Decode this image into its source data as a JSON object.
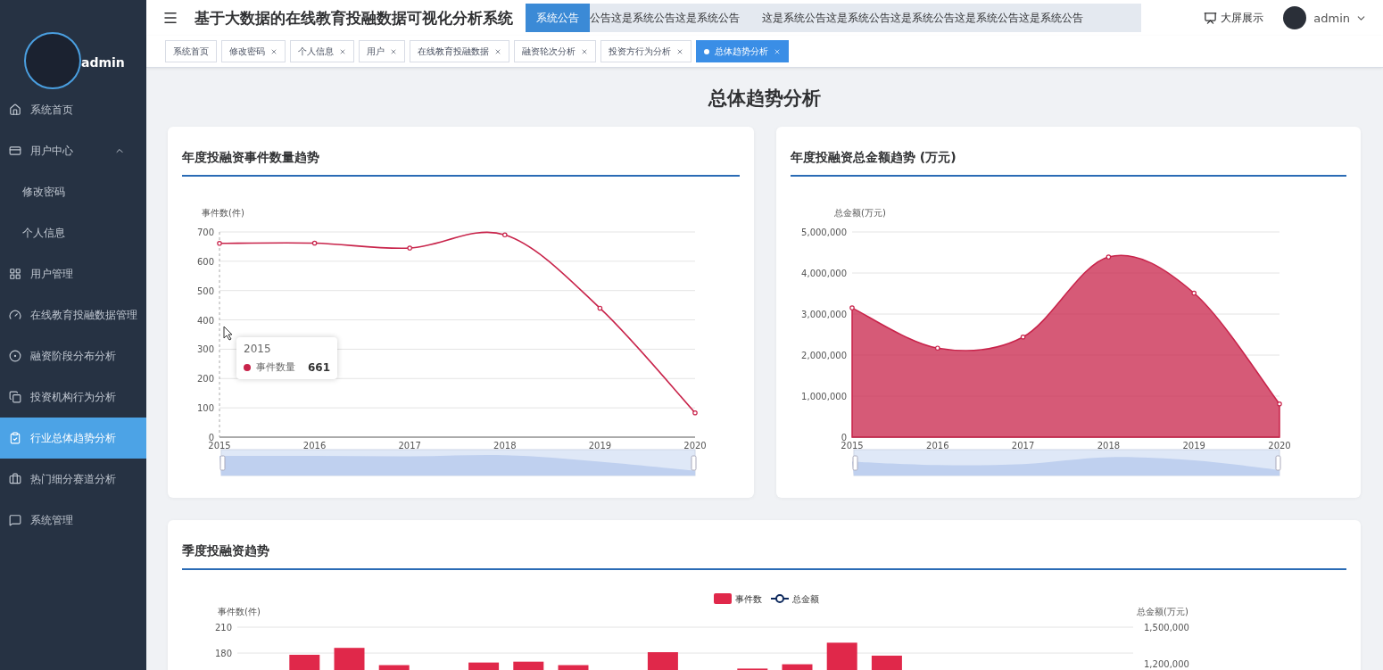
{
  "header": {
    "title": "基于大数据的在线教育投融数据可视化分析系统",
    "notice_label": "系统公告",
    "notice_texts": [
      "公告这是系统公告这是系统公告",
      "这是系统公告这是系统公告这是系统公告这是系统公告这是系统公告"
    ],
    "screen_button": "大屏展示",
    "user": "admin"
  },
  "sidebar": {
    "user": "admin",
    "items": [
      {
        "label": "系统首页",
        "selected": false
      },
      {
        "label": "用户中心",
        "selected": false,
        "expanded": true,
        "children": [
          {
            "label": "修改密码",
            "selected": false
          },
          {
            "label": "个人信息",
            "selected": false
          }
        ]
      },
      {
        "label": "用户管理",
        "selected": false
      },
      {
        "label": "在线教育投融数据管理",
        "selected": false
      },
      {
        "label": "融资阶段分布分析",
        "selected": false
      },
      {
        "label": "投资机构行为分析",
        "selected": false
      },
      {
        "label": "行业总体趋势分析",
        "selected": true
      },
      {
        "label": "热门细分赛道分析",
        "selected": false
      },
      {
        "label": "系统管理",
        "selected": false
      }
    ]
  },
  "tabs": [
    {
      "label": "系统首页",
      "selected": false,
      "closable": false
    },
    {
      "label": "修改密码",
      "selected": false,
      "closable": true
    },
    {
      "label": "个人信息",
      "selected": false,
      "closable": true
    },
    {
      "label": "用户",
      "selected": false,
      "closable": true
    },
    {
      "label": "在线教育投融数据",
      "selected": false,
      "closable": true
    },
    {
      "label": "融资轮次分析",
      "selected": false,
      "closable": true
    },
    {
      "label": "投资方行为分析",
      "selected": false,
      "closable": true
    },
    {
      "label": "总体趋势分析",
      "selected": true,
      "closable": true
    }
  ],
  "page_title": "总体趋势分析",
  "cards": [
    {
      "title": "年度投融资事件数量趋势",
      "tooltip": {
        "title": "2015",
        "value": "661"
      },
      "chart_data": {
        "type": "line",
        "grid": true,
        "ylabel": "事件数(件)",
        "categories": [
          "2015",
          "2016",
          "2017",
          "2018",
          "2019",
          "2020"
        ],
        "ylim": [
          0,
          700
        ],
        "yticks": [
          0,
          100,
          200,
          300,
          400,
          500,
          600,
          700
        ],
        "series": [
          {
            "name": "事件数量",
            "color": "#c8234a",
            "marker": true,
            "values": [
              661,
              662,
              645,
              690,
              440,
              83
            ]
          }
        ]
      }
    },
    {
      "title": "年度投融资总金额趋势 (万元)",
      "chart_data": {
        "type": "area",
        "grid": true,
        "ylabel": "总金额(万元)",
        "categories": [
          "2015",
          "2016",
          "2017",
          "2018",
          "2019",
          "2020"
        ],
        "ylim": [
          0,
          5000000
        ],
        "yticks": [
          {
            "value": 0,
            "label": "0"
          },
          {
            "value": 1000000,
            "label": "1,000,000"
          },
          {
            "value": 2000000,
            "label": "2,000,000"
          },
          {
            "value": 3000000,
            "label": "3,000,000"
          },
          {
            "value": 4000000,
            "label": "4,000,000"
          },
          {
            "value": 5000000,
            "label": "5,000,000"
          }
        ],
        "series": [
          {
            "color": "#c8234a",
            "marker": true,
            "values": [
              3150000,
              2170000,
              2440000,
              4390000,
              3510000,
              810000
            ]
          }
        ]
      }
    },
    {
      "title": "季度投融资趋势",
      "line": {
        "name": "总金额",
        "color": "#0f2a5e"
      },
      "right_axis": {
        "label": "总金额(万元)",
        "ticks": [
          "1,500,000",
          "1,200,000"
        ]
      },
      "chart_data": {
        "type": "bar",
        "grid": true,
        "ylabel": "事件数(件)",
        "ylim": [
          0,
          210
        ],
        "yticks": [
          180,
          210
        ],
        "series": [
          {
            "name": "事件数",
            "color": "#e0284a",
            "values": [
              null,
              178,
              186,
              166,
              null,
              169,
              170,
              166,
              null,
              181,
              null,
              162,
              167,
              192,
              177,
              null,
              null,
              null,
              null,
              null
            ]
          }
        ]
      }
    }
  ]
}
